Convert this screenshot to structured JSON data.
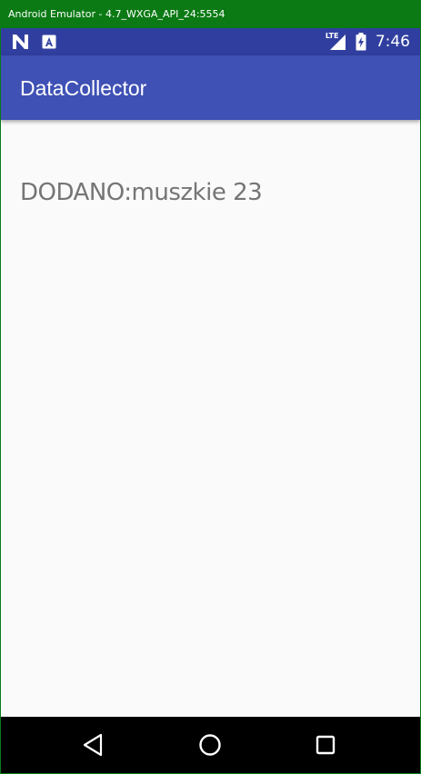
{
  "window": {
    "title": "Android Emulator - 4.7_WXGA_API_24:5554"
  },
  "status_bar": {
    "notification_icons": [
      "n-icon",
      "a-icon"
    ],
    "network_label": "LTE",
    "time": "7:46"
  },
  "app_bar": {
    "title": "DataCollector"
  },
  "main": {
    "message": "DODANO:muszkie 23"
  },
  "nav_bar": {
    "buttons": [
      "back-icon",
      "home-icon",
      "recents-icon"
    ]
  },
  "colors": {
    "status_bar": "#303f9f",
    "app_bar": "#3f51b5",
    "background": "#fafafa",
    "message_text": "#757575",
    "window_frame": "#0b7a14"
  }
}
